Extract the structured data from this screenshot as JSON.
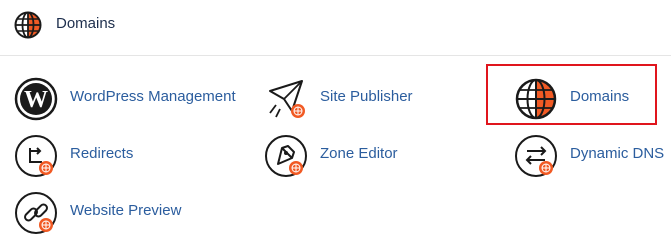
{
  "header": {
    "title": "Domains",
    "icon": "globe-icon"
  },
  "items": [
    {
      "label": "WordPress Management",
      "icon": "wordpress-icon"
    },
    {
      "label": "Site Publisher",
      "icon": "paper-plane-icon"
    },
    {
      "label": "Domains",
      "icon": "globe-icon",
      "highlighted": true
    },
    {
      "label": "Redirects",
      "icon": "redirect-icon"
    },
    {
      "label": "Zone Editor",
      "icon": "rocket-icon"
    },
    {
      "label": "Dynamic DNS",
      "icon": "swap-arrows-icon"
    },
    {
      "label": "Website Preview",
      "icon": "chain-link-icon"
    }
  ],
  "colors": {
    "accent": "#f15a24",
    "link": "#2b5d9e",
    "highlight_border": "#e0151d"
  }
}
